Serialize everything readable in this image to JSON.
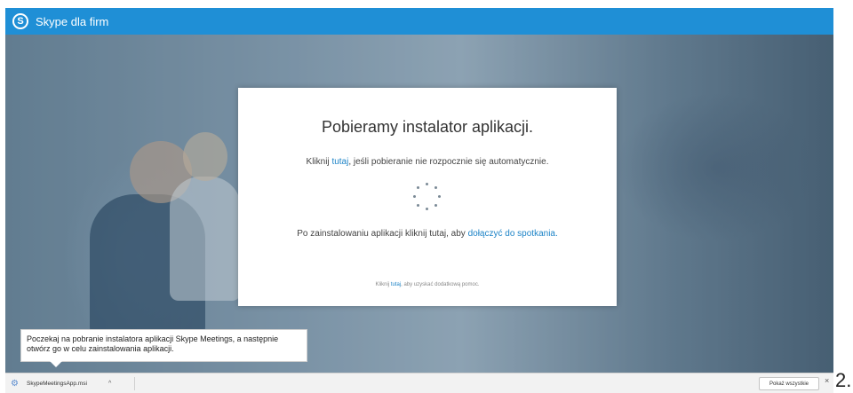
{
  "topbar": {
    "logo": "S",
    "title": "Skype dla firm"
  },
  "dialog": {
    "title": "Pobieramy instalator aplikacji.",
    "line1_prefix": "Kliknij ",
    "line1_link": "tutaj",
    "line1_suffix": ", jeśli pobieranie nie rozpocznie się automatycznie.",
    "line2_prefix": "Po zainstalowaniu aplikacji kliknij tutaj, aby ",
    "line2_link": "dołączyć do spotkania.",
    "help_prefix": "Kliknij ",
    "help_link": "tutaj",
    "help_suffix": ", aby uzyskać dodatkową pomoc."
  },
  "tooltip": {
    "text": "Poczekaj na pobranie instalatora aplikacji Skype Meetings, a następnie otwórz go w celu zainstalowania aplikacji."
  },
  "download_bar": {
    "file_name": "SkypeMeetingsApp.msi",
    "caret": "^",
    "show_all": "Pokaż wszystkie",
    "close": "×"
  },
  "page_number": "2.",
  "icons": {
    "file_icon": "installer-file-icon",
    "spinner": "loading-spinner"
  },
  "colors": {
    "brand": "#1f8fd6",
    "link": "#1e84c7"
  }
}
